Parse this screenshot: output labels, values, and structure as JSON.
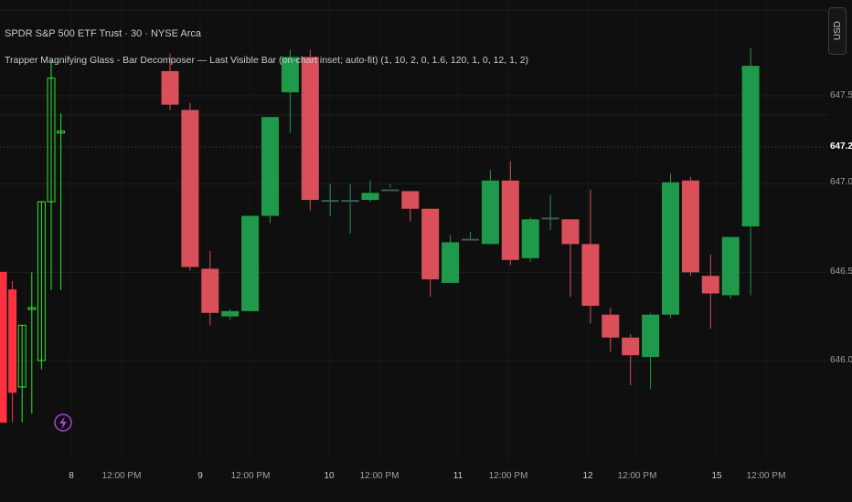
{
  "header": {
    "symbol_line": "SPDR S&P 500 ETF Trust · 30 · NYSE Arca",
    "indicator_line": "Trapper Magnifying Glass - Bar Decomposer — Last Visible Bar (on-chart inset; auto-fit) (1, 10, 2, 0, 1.6, 120, 1, 0, 12, 1, 2)"
  },
  "currency_button": "USD",
  "price_axis": {
    "ticks": [
      "647.50",
      "647.21",
      "647.00",
      "646.50",
      "646.00"
    ],
    "current_price": "647.21"
  },
  "time_axis": {
    "labels": [
      "8",
      "12:00 PM",
      "9",
      "12:00 PM",
      "10",
      "12:00 PM",
      "11",
      "12:00 PM",
      "12",
      "12:00 PM",
      "15",
      "12:00 PM"
    ]
  },
  "colors": {
    "up": "#1f9a4a",
    "down": "#d9505a",
    "inset_up": "#2ee82e",
    "inset_down": "#ff3340",
    "background": "#0f0f0f",
    "logo": "#b042d6"
  },
  "icons": {
    "logo": "lightning-icon"
  },
  "chart_data": {
    "type": "candlestick",
    "ylim": [
      645.55,
      648.1
    ],
    "candles": [
      {
        "o": 647.64,
        "h": 647.74,
        "l": 647.42,
        "c": 647.45
      },
      {
        "o": 647.42,
        "h": 647.46,
        "l": 646.51,
        "c": 646.53
      },
      {
        "o": 646.52,
        "h": 646.62,
        "l": 646.2,
        "c": 646.27
      },
      {
        "o": 646.25,
        "h": 646.29,
        "l": 646.23,
        "c": 646.28
      },
      {
        "o": 646.28,
        "h": 646.82,
        "l": 646.28,
        "c": 646.82
      },
      {
        "o": 646.82,
        "h": 647.38,
        "l": 646.78,
        "c": 647.38
      },
      {
        "o": 647.52,
        "h": 647.76,
        "l": 647.29,
        "c": 647.72
      },
      {
        "o": 647.72,
        "h": 647.76,
        "l": 646.85,
        "c": 646.91
      },
      {
        "o": 646.91,
        "h": 647.0,
        "l": 646.82,
        "c": 646.91
      },
      {
        "o": 646.91,
        "h": 647.0,
        "l": 646.72,
        "c": 646.91
      },
      {
        "o": 646.91,
        "h": 647.02,
        "l": 646.9,
        "c": 646.95
      },
      {
        "o": 646.97,
        "h": 647.0,
        "l": 646.98,
        "c": 646.97
      },
      {
        "o": 646.96,
        "h": 646.96,
        "l": 646.79,
        "c": 646.86
      },
      {
        "o": 646.86,
        "h": 646.86,
        "l": 646.36,
        "c": 646.46
      },
      {
        "o": 646.44,
        "h": 646.71,
        "l": 646.44,
        "c": 646.67
      },
      {
        "o": 646.69,
        "h": 646.73,
        "l": 646.69,
        "c": 646.69
      },
      {
        "o": 646.66,
        "h": 647.08,
        "l": 646.72,
        "c": 647.02
      },
      {
        "o": 647.02,
        "h": 647.13,
        "l": 646.54,
        "c": 646.57
      },
      {
        "o": 646.58,
        "h": 646.81,
        "l": 646.56,
        "c": 646.8
      },
      {
        "o": 646.8,
        "h": 646.94,
        "l": 646.74,
        "c": 646.81
      },
      {
        "o": 646.8,
        "h": 646.8,
        "l": 646.36,
        "c": 646.66
      },
      {
        "o": 646.66,
        "h": 646.97,
        "l": 646.21,
        "c": 646.31
      },
      {
        "o": 646.26,
        "h": 646.3,
        "l": 646.05,
        "c": 646.13
      },
      {
        "o": 646.13,
        "h": 646.15,
        "l": 645.86,
        "c": 646.03
      },
      {
        "o": 646.02,
        "h": 646.27,
        "l": 645.84,
        "c": 646.26
      },
      {
        "o": 646.26,
        "h": 647.06,
        "l": 646.24,
        "c": 647.01
      },
      {
        "o": 647.02,
        "h": 647.04,
        "l": 646.48,
        "c": 646.5
      },
      {
        "o": 646.48,
        "h": 646.6,
        "l": 646.18,
        "c": 646.38
      },
      {
        "o": 646.37,
        "h": 646.7,
        "l": 646.35,
        "c": 646.7
      },
      {
        "o": 646.76,
        "h": 647.77,
        "l": 646.37,
        "c": 647.67
      }
    ]
  },
  "inset": {
    "bars": [
      {
        "o": 646.5,
        "h": 646.5,
        "l": 645.65,
        "c": 645.65
      },
      {
        "o": 646.4,
        "h": 646.45,
        "l": 645.65,
        "c": 645.82
      },
      {
        "o": 645.85,
        "h": 646.2,
        "l": 645.65,
        "c": 646.2
      },
      {
        "o": 646.3,
        "h": 646.5,
        "l": 645.7,
        "c": 646.3
      },
      {
        "o": 646.0,
        "h": 646.9,
        "l": 645.95,
        "c": 646.9
      },
      {
        "o": 646.9,
        "h": 647.7,
        "l": 646.4,
        "c": 647.6
      },
      {
        "o": 647.3,
        "h": 647.4,
        "l": 646.4,
        "c": 647.3
      }
    ]
  }
}
